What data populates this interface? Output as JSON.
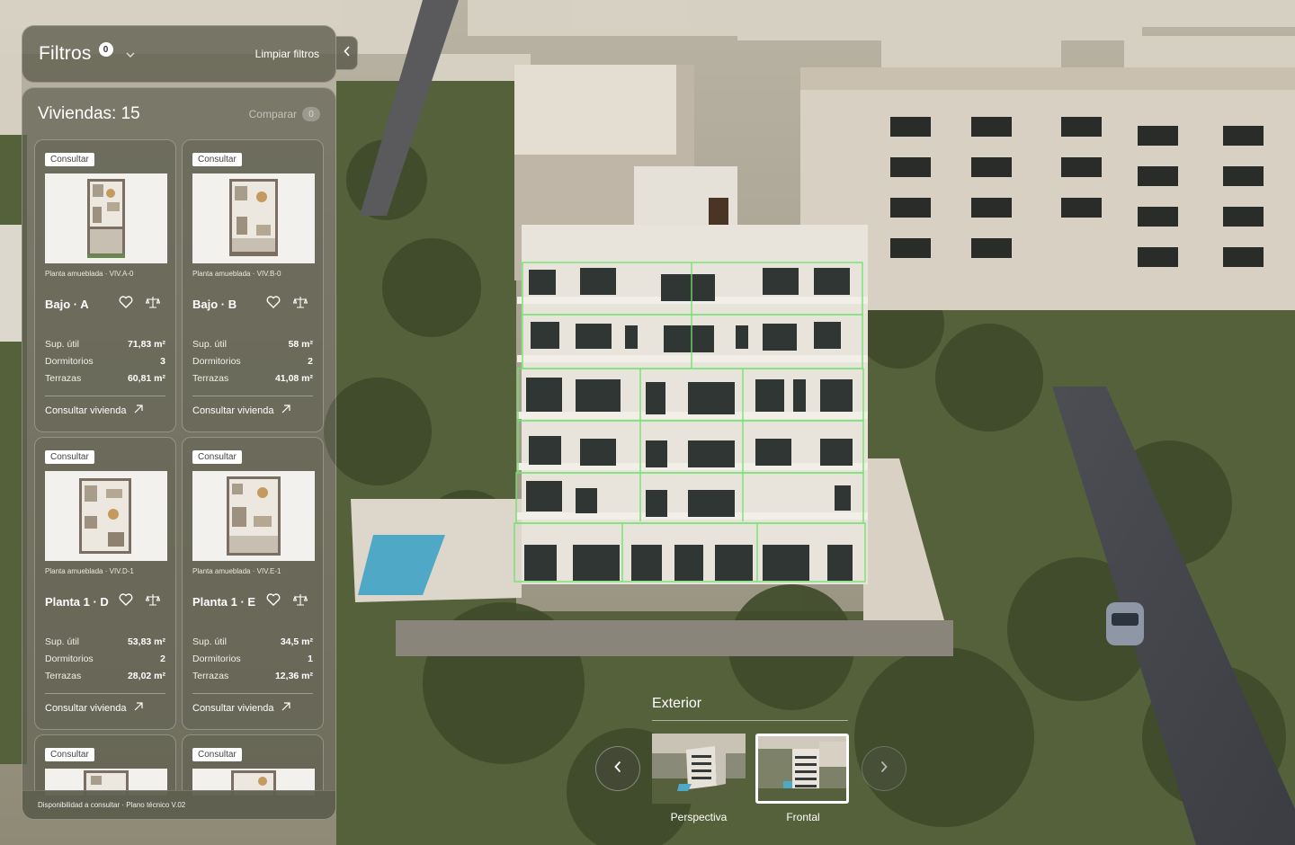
{
  "filters": {
    "title": "Filtros",
    "active_count": "0",
    "clear_label": "Limpiar filtros"
  },
  "listings": {
    "title": "Viviendas: 15",
    "compare_label": "Comparar",
    "compare_count": "0",
    "footer": "Disponibilidad a consultar · Plano técnico V.02",
    "spec_labels": {
      "area": "Sup. útil",
      "bedrooms": "Dormitorios",
      "terraces": "Terrazas"
    },
    "consult_label": "Consultar vivienda",
    "cards": [
      {
        "badge": "Consultar",
        "caption": "Planta amueblada · VIV.A-0",
        "title": "Bajo · A",
        "area": "71,83 m²",
        "bedrooms": "3",
        "terraces": "60,81 m²"
      },
      {
        "badge": "Consultar",
        "caption": "Planta amueblada · VIV.B-0",
        "title": "Bajo · B",
        "area": "58 m²",
        "bedrooms": "2",
        "terraces": "41,08 m²"
      },
      {
        "badge": "Consultar",
        "caption": "Planta amueblada · VIV.D-1",
        "title": "Planta 1 · D",
        "area": "53,83 m²",
        "bedrooms": "2",
        "terraces": "28,02 m²"
      },
      {
        "badge": "Consultar",
        "caption": "Planta amueblada · VIV.E-1",
        "title": "Planta 1 · E",
        "area": "34,5 m²",
        "bedrooms": "1",
        "terraces": "12,36 m²"
      },
      {
        "badge": "Consultar"
      },
      {
        "badge": "Consultar"
      }
    ]
  },
  "views": {
    "title": "Exterior",
    "items": [
      {
        "label": "Perspectiva",
        "selected": false
      },
      {
        "label": "Frontal",
        "selected": true
      }
    ]
  },
  "icons": {
    "filters_chevron": "chevron-down-icon",
    "collapse": "chevron-left-icon",
    "favorite": "heart-icon",
    "compare": "scale-icon",
    "external": "arrow-up-right-icon",
    "prev": "chevron-left-icon",
    "next": "chevron-right-icon"
  },
  "colors": {
    "panel": "#5c5c4c",
    "highlight": "#6ee36b",
    "text": "#ffffff"
  }
}
